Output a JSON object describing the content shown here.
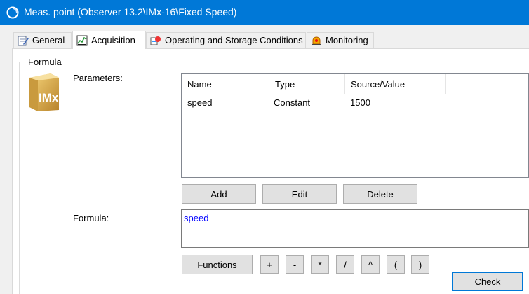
{
  "window": {
    "title": "Meas. point (Observer 13.2\\IMx-16\\Fixed Speed)"
  },
  "tabs": [
    {
      "label": "General",
      "icon": "document-edit-icon",
      "active": false
    },
    {
      "label": "Acquisition",
      "icon": "chart-acquisition-icon",
      "active": true
    },
    {
      "label": "Operating and Storage Conditions",
      "icon": "conditions-icon",
      "active": false
    },
    {
      "label": "Monitoring",
      "icon": "alarm-light-icon",
      "active": false
    }
  ],
  "group": {
    "label": "Formula",
    "logo_text": "IMx"
  },
  "parameters": {
    "label": "Parameters:",
    "columns": [
      "Name",
      "Type",
      "Source/Value"
    ],
    "rows": [
      [
        "speed",
        "Constant",
        "1500"
      ]
    ],
    "buttons": {
      "add": "Add",
      "edit": "Edit",
      "delete": "Delete"
    }
  },
  "formula": {
    "label": "Formula:",
    "value": "speed"
  },
  "operators": {
    "functions": "Functions",
    "plus": "+",
    "minus": "-",
    "multiply": "*",
    "divide": "/",
    "power": "^",
    "open_paren": "(",
    "close_paren": ")"
  },
  "check_button": "Check",
  "colors": {
    "titlebar": "#0078d7",
    "formula_text": "#0000ff",
    "accent": "#0078d7"
  }
}
